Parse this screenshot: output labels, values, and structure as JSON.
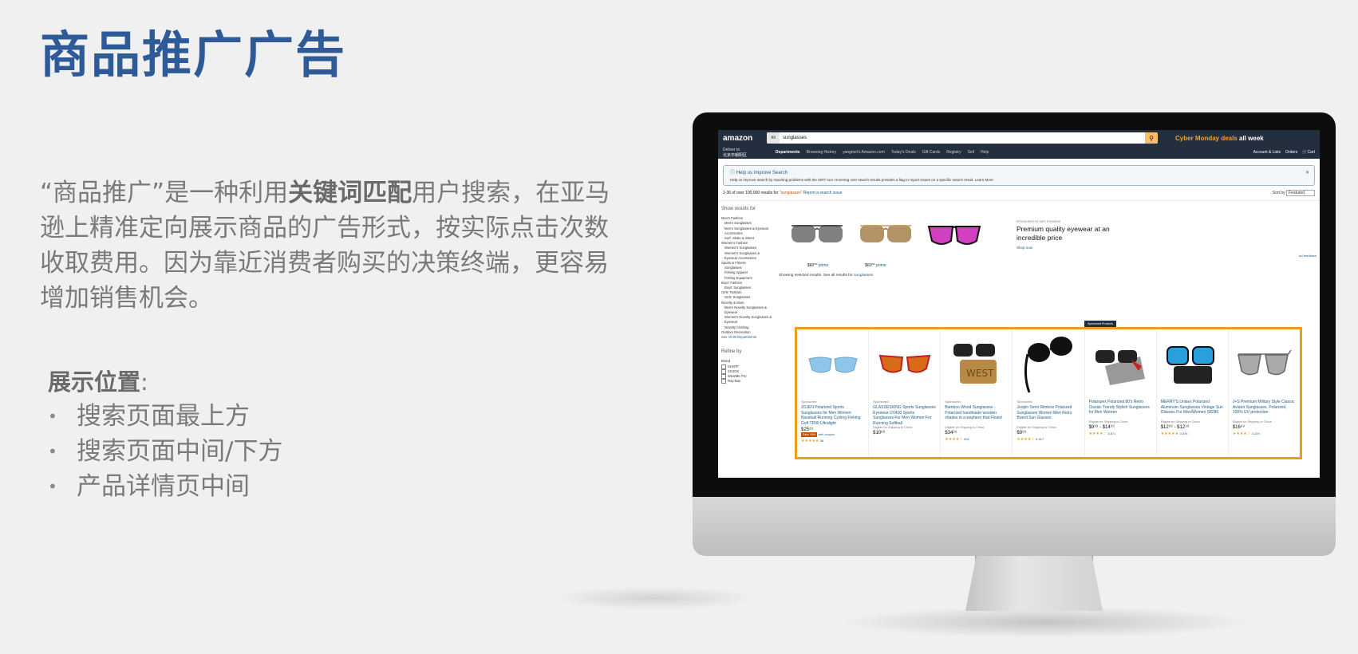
{
  "slide": {
    "title": "商品推广广告",
    "desc_pre": "“商品推广”是一种利用",
    "desc_bold": "关键词匹配",
    "desc_post": "用户搜索，在亚马逊上精准定向展示商品的广告形式，按实际点击次数收取费用。因为靠近消费者购买的决策终端，更容易增加销售机会。",
    "positions_label": "展示位置",
    "positions_colon": ":",
    "positions": [
      "搜索页面最上方",
      "搜索页面中间/下方",
      "产品详情页中间"
    ]
  },
  "amazon": {
    "logo": "amazon",
    "search_category": "All",
    "search_value": "sunglasses",
    "cyber_deal": "Cyber Monday deals",
    "cyber_week": "all week",
    "deliver_line1": "Deliver to",
    "deliver_line2": "北京市朝阳区",
    "departments": "Departments",
    "nav_links": [
      "Browsing History",
      "yangmei's Amazon.com",
      "Today's Deals",
      "Gift Cards",
      "Registry",
      "Sell",
      "Help"
    ],
    "account": "Account & Lists",
    "orders": "Orders",
    "cart": "Cart",
    "help_title": "Help us Improve Search",
    "help_text": "Help us improve search by reporting problems with the SIRT tool. Hovering over search results provides a flag to report issues on a specific search result. Learn More",
    "results_text": "1-36 of over 100,000 results for",
    "results_query": "\"sunglasses\"",
    "report_issue": "Report a search issue",
    "sort_label": "Sort by",
    "sort_value": "Featured",
    "sidebar_title": "Show results for",
    "sidebar_items": [
      "Men's Fashion",
      "Men's Sunglasses",
      "Men's Sunglasses & Eyewear Accessories",
      "Surf, Skate & Street",
      "Women's Fashion",
      "Women's Sunglasses",
      "Women's Sunglasses & Eyewear Accessories",
      "Sports & Fitness",
      "Sunglasses",
      "Fishing Apparel",
      "Fishing Equipment",
      "Boys' Fashion",
      "Boys' Sunglasses",
      "Girls' Fashion",
      "Girls' Sunglasses",
      "Novelty & More",
      "Men's Novelty Sunglasses & Eyewear",
      "Women's Novelty Sunglasses & Eyewear",
      "Novelty Clothing",
      "Outdoor Recreation",
      "See All 39 Departments"
    ],
    "refine": "Refine by",
    "brand_label": "Brand",
    "brands": [
      "SHNTF",
      "SOJOS",
      "WearMe Pro",
      "Ray-Ban"
    ],
    "brand_sponsor": "SPONSORED BY DIFF EYEWEAR",
    "brand_headline": "Premium quality eyewear at an incredible price",
    "brand_link": "Shop now",
    "brand_prices": [
      "$60⁰⁰",
      "$60⁰⁰"
    ],
    "prime": "prime",
    "showing_text": "Showing selected results. See all results for",
    "showing_link": "sunglasses",
    "ad_feedback": "Ad feedback",
    "sponsored_badge": "Sponsored Products",
    "products": [
      {
        "sponsored": "Sponsored",
        "name": "JOJEN Polarized Sports Sunglasses for Men Women Baseball Running Cycling Fishing Golf TR90 Ultralight",
        "ship": "",
        "price": "$25⁹⁹",
        "deal": "Save 15%",
        "coupon": "with coupon",
        "reviews": "58"
      },
      {
        "sponsored": "Sponsored",
        "name": "GLASSESKING Sports Sunglasses Eyewear UV400 Sports Sunglasses For Men Women For Running Softball",
        "ship": "Eligible for Shipping to China",
        "price": "$10⁸⁹",
        "deal": "",
        "coupon": "",
        "reviews": ""
      },
      {
        "sponsored": "Sponsored",
        "name": "Bamboo Wood Sunglasses - Polarized handmade wooden shades in a wayfarer that Floats!",
        "ship": "Eligible for Shipping to China",
        "price": "$34⁹⁵",
        "deal": "",
        "coupon": "",
        "reviews": "591"
      },
      {
        "sponsored": "Sponsored",
        "name": "Joopin Semi Rimless Polarized Sunglasses Women Men Retro Brand Sun Glasses",
        "ship": "Eligible for Shipping to China",
        "price": "$9⁹⁹",
        "deal": "",
        "coupon": "",
        "reviews": "5,917"
      },
      {
        "sponsored": "",
        "name": "Polarspex Polarized 80's Retro Classic Trendy Stylish Sunglasses for Men Women",
        "ship": "Eligible for Shipping to China",
        "price": "$9⁹⁹ - $14⁹⁹",
        "deal": "",
        "coupon": "",
        "reviews": "3,871"
      },
      {
        "sponsored": "",
        "name": "MERRY'S Unisex Polarized Aluminum Sunglasses Vintage Sun Glasses For Men/Women S8286",
        "ship": "Eligible for Shipping to China",
        "price": "$12⁹⁹ - $12⁹⁹",
        "deal": "",
        "coupon": "",
        "reviews": "3,576"
      },
      {
        "sponsored": "",
        "name": "J+S Premium Military Style Classic Aviator Sunglasses, Polarized, 100% UV protection",
        "ship": "Eligible for Shipping to China",
        "price": "$16⁹⁹",
        "deal": "",
        "coupon": "",
        "reviews": "4,229"
      }
    ],
    "highlight_color": "#ef9c1b"
  }
}
